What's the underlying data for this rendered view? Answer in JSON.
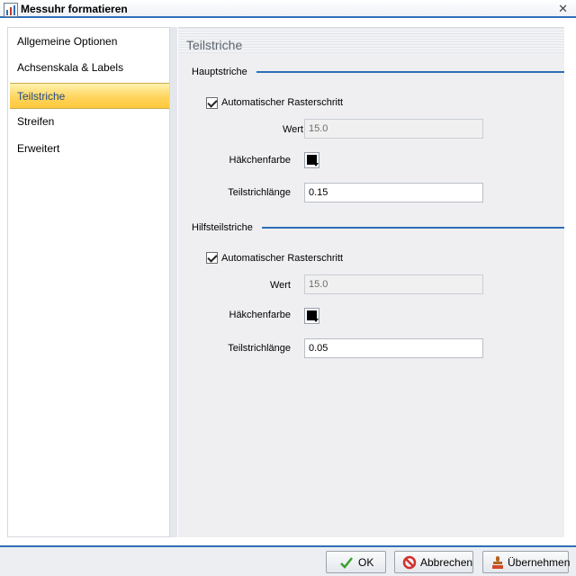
{
  "window": {
    "title": "Messuhr formatieren"
  },
  "sidebar": {
    "items": [
      {
        "label": "Allgemeine Optionen"
      },
      {
        "label": "Achsenskala & Labels"
      },
      {
        "label": "Teilstriche"
      },
      {
        "label": "Streifen"
      },
      {
        "label": "Erweitert"
      }
    ],
    "active_index": 2
  },
  "panel": {
    "title": "Teilstriche",
    "major": {
      "title": "Hauptstriche",
      "auto_label": "Automatischer Rasterschritt",
      "auto_checked": true,
      "value_label": "Wert",
      "value": "15.0",
      "color_label": "Häkchenfarbe",
      "color": "#000000",
      "length_label": "Teilstrichlänge",
      "length": "0.15"
    },
    "minor": {
      "title": "Hilfsteilstriche",
      "auto_label": "Automatischer Rasterschritt",
      "auto_checked": true,
      "value_label": "Wert",
      "value": "15.0",
      "color_label": "Häkchenfarbe",
      "color": "#000000",
      "length_label": "Teilstrichlänge",
      "length": "0.05"
    }
  },
  "footer": {
    "ok_label": "OK",
    "cancel_label": "Abbrechen",
    "apply_label": "Übernehmen"
  },
  "colors": {
    "accent": "#2f6fb8",
    "active_item": "#ffd45e"
  }
}
